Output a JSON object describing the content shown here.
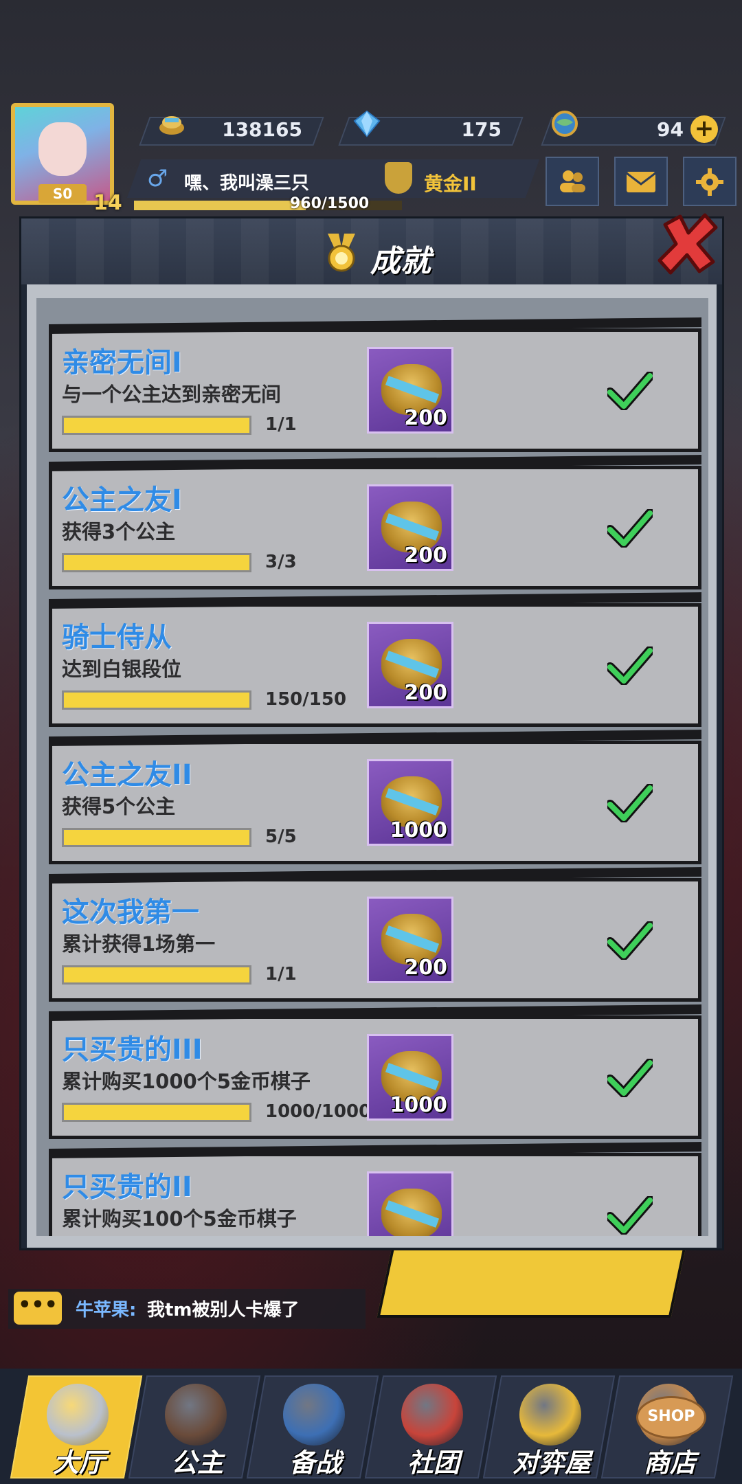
{
  "hud": {
    "level": "14",
    "rank_badge": "S0",
    "resources": [
      {
        "icon": "coin-pile-icon",
        "value": "138165"
      },
      {
        "icon": "blue-gem-icon",
        "value": "175"
      },
      {
        "icon": "globe-token-icon",
        "value": "94"
      }
    ],
    "player_name": "嘿、我叫澡三只",
    "tier": "黄金II",
    "xp_text": "960/1500",
    "xp_progress": 0.64
  },
  "modal": {
    "title": "成就",
    "achievements": [
      {
        "title": "亲密无间I",
        "desc": "与一个公主达到亲密无间",
        "progress_text": "1/1",
        "progress": 1.0,
        "reward": "200"
      },
      {
        "title": "公主之友I",
        "desc": "获得3个公主",
        "progress_text": "3/3",
        "progress": 1.0,
        "reward": "200"
      },
      {
        "title": "骑士侍从",
        "desc": "达到白银段位",
        "progress_text": "150/150",
        "progress": 1.0,
        "reward": "200"
      },
      {
        "title": "公主之友II",
        "desc": "获得5个公主",
        "progress_text": "5/5",
        "progress": 1.0,
        "reward": "1000"
      },
      {
        "title": "这次我第一",
        "desc": "累计获得1场第一",
        "progress_text": "1/1",
        "progress": 1.0,
        "reward": "200"
      },
      {
        "title": "只买贵的III",
        "desc": "累计购买1000个5金币棋子",
        "progress_text": "1000/1000",
        "progress": 1.0,
        "reward": "1000"
      },
      {
        "title": "只买贵的II",
        "desc": "累计购买100个5金币棋子",
        "progress_text": "",
        "progress": 1.0,
        "reward": ""
      }
    ]
  },
  "chat": {
    "name": "牛苹果:",
    "message": "我tm被别人卡爆了"
  },
  "nav": {
    "tabs": [
      {
        "label": "大厅",
        "icon": "crossed-swords-icon",
        "active": true
      },
      {
        "label": "公主",
        "icon": "princess-icon",
        "active": false
      },
      {
        "label": "备战",
        "icon": "chess-pieces-icon",
        "active": false
      },
      {
        "label": "社团",
        "icon": "guild-house-icon",
        "active": false
      },
      {
        "label": "对弈屋",
        "icon": "knight-coin-icon",
        "active": false
      },
      {
        "label": "商店",
        "icon": "shop-sign-icon",
        "active": false
      }
    ],
    "shop_sign_text": "SHOP"
  },
  "colors": {
    "achievement_title": "#2f8be6",
    "progress_fill": "#f5d43e",
    "check": "#3fcf5a",
    "active_tab": "#f3c534"
  }
}
